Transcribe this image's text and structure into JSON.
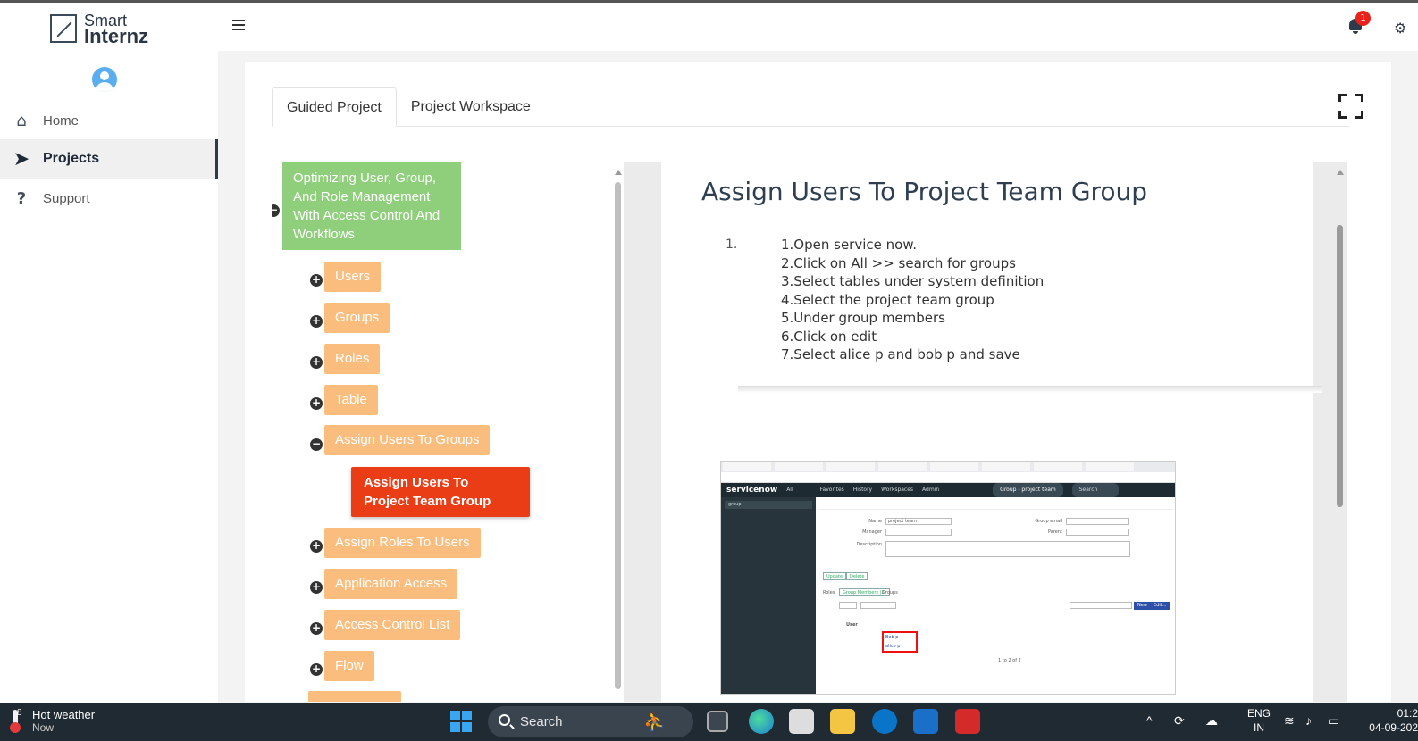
{
  "app": {
    "logo_line1": "Smart",
    "logo_line2": "Internz",
    "notification_count": "1"
  },
  "sidebar": {
    "items": [
      {
        "label": "Home",
        "icon": "home-icon"
      },
      {
        "label": "Projects",
        "icon": "paper-plane-icon",
        "active": true
      },
      {
        "label": "Support",
        "icon": "question-icon"
      }
    ]
  },
  "tabs": [
    {
      "label": "Guided Project",
      "active": true
    },
    {
      "label": "Project Workspace",
      "active": false
    }
  ],
  "tree": {
    "root": "Optimizing User, Group, And Role Management With Access Control And Workflows",
    "nodes": [
      {
        "label": "Users",
        "toggle": "+"
      },
      {
        "label": "Groups",
        "toggle": "+"
      },
      {
        "label": "Roles",
        "toggle": "+"
      },
      {
        "label": "Table",
        "toggle": "+"
      },
      {
        "label": "Assign Users To Groups",
        "toggle": "−"
      },
      {
        "label": "Assign Users To Project Team Group",
        "selected": true
      },
      {
        "label": "Assign Roles To Users",
        "toggle": "+"
      },
      {
        "label": "Application Access",
        "toggle": "+"
      },
      {
        "label": "Access Control List",
        "toggle": "+"
      },
      {
        "label": "Flow",
        "toggle": "+"
      }
    ]
  },
  "content": {
    "title": "Assign Users To Project Team Group",
    "list_number": "1.",
    "steps": [
      "1.Open service now.",
      "2.Click on All  >> search for groups",
      "3.Select tables under system definition",
      "4.Select the project team group",
      "5.Under group members",
      "6.Click on edit",
      "7.Select  alice p and bob p and save"
    ]
  },
  "embedded": {
    "brand": "servicenow",
    "menu": [
      "All",
      "Favorites",
      "History",
      "Workspaces",
      "Admin"
    ],
    "group_pill": "Group - project team",
    "search_placeholder": "Search",
    "filter_value": "group",
    "name_label": "Name",
    "name_value": "project team",
    "manager_label": "Manager",
    "description_label": "Description",
    "group_email_label": "Group email",
    "parent_label": "Parent",
    "update_btn": "Update",
    "delete_btn": "Delete",
    "roles_tab": "Roles",
    "members_tab": "Group Members (2)",
    "groups_tab": "Groups",
    "new_btn": "New",
    "edit_btn": "Edit...",
    "user_col": "User",
    "member1": "Bob p",
    "member2": "alice p",
    "pager": "1 to 2 of 2"
  },
  "taskbar": {
    "weather_title": "Hot weather",
    "weather_sub": "Now",
    "weather_badge": "8",
    "search_label": "Search",
    "lang_top": "ENG",
    "lang_bottom": "IN",
    "time": "01:2",
    "date": "04-09-202"
  }
}
